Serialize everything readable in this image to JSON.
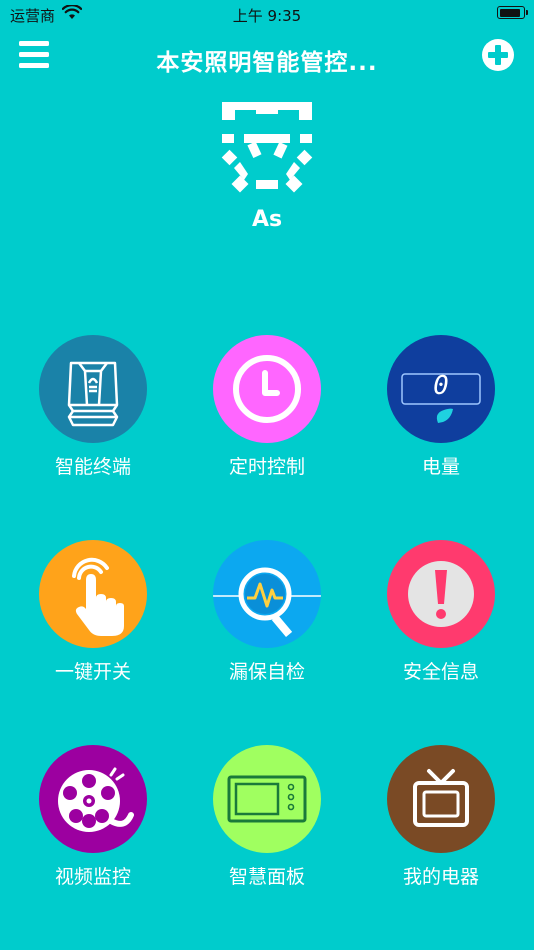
{
  "status_bar": {
    "carrier": "运营商",
    "time": "上午 9:35",
    "wifi_icon": "wifi-icon",
    "battery_icon": "battery-icon"
  },
  "nav": {
    "title": "本安照明智能管控...",
    "menu_icon": "hamburger-menu-icon",
    "add_icon": "plus-circle-icon"
  },
  "logo": {
    "icon": "anan-logo-icon",
    "label": "As"
  },
  "colors": {
    "background": "#00cccc",
    "terminal": "#1a82a8",
    "timer": "#ff66ff",
    "power": "#0f3e9e",
    "switch": "#ffa31a",
    "leak_test": "#0ca8f0",
    "safety": "#ff3a6e",
    "video": "#9c00a0",
    "panel": "#a0ff60",
    "appliance": "#7a4a25"
  },
  "grid": [
    {
      "label": "智能终端",
      "icon": "smart-terminal-icon"
    },
    {
      "label": "定时控制",
      "icon": "clock-icon"
    },
    {
      "label": "电量",
      "icon": "power-meter-icon",
      "meter_value": "0"
    },
    {
      "label": "一键开关",
      "icon": "tap-hand-icon"
    },
    {
      "label": "漏保自检",
      "icon": "magnifier-pulse-icon"
    },
    {
      "label": "安全信息",
      "icon": "exclamation-icon"
    },
    {
      "label": "视频监控",
      "icon": "film-reel-icon"
    },
    {
      "label": "智慧面板",
      "icon": "control-panel-icon"
    },
    {
      "label": "我的电器",
      "icon": "tv-icon"
    }
  ]
}
